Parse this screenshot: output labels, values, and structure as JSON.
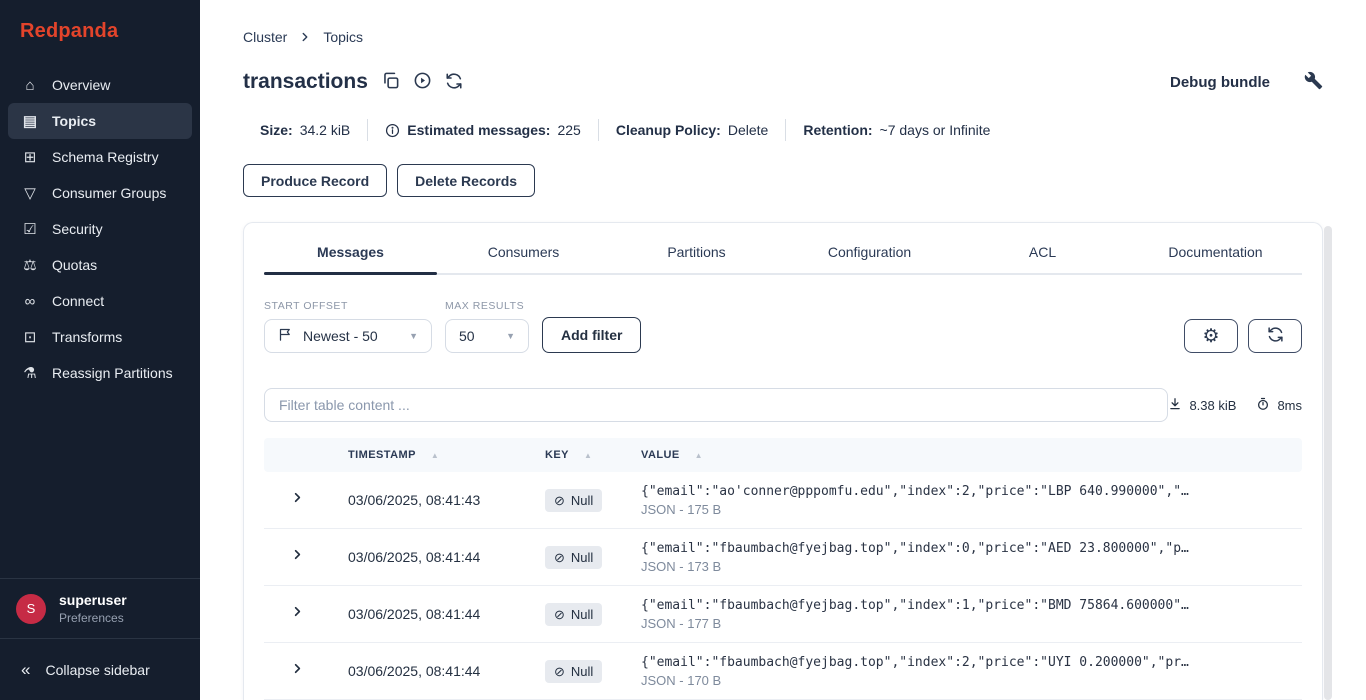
{
  "sidebar": {
    "logo": "Redpanda",
    "items": [
      {
        "label": "Overview",
        "icon": "home-icon",
        "glyph": "⌂",
        "active": false
      },
      {
        "label": "Topics",
        "icon": "topics-icon",
        "glyph": "▤",
        "active": true
      },
      {
        "label": "Schema Registry",
        "icon": "schema-registry-icon",
        "glyph": "⊞",
        "active": false
      },
      {
        "label": "Consumer Groups",
        "icon": "consumer-groups-icon",
        "glyph": "▽",
        "active": false
      },
      {
        "label": "Security",
        "icon": "security-shield-icon",
        "glyph": "☑",
        "active": false
      },
      {
        "label": "Quotas",
        "icon": "quotas-scales-icon",
        "glyph": "⚖",
        "active": false
      },
      {
        "label": "Connect",
        "icon": "connect-link-icon",
        "glyph": "∞",
        "active": false
      },
      {
        "label": "Transforms",
        "icon": "transforms-icon",
        "glyph": "⊡",
        "active": false
      },
      {
        "label": "Reassign Partitions",
        "icon": "reassign-partitions-icon",
        "glyph": "⚗",
        "active": false
      }
    ],
    "user": {
      "initial": "S",
      "name": "superuser",
      "sub": "Preferences"
    },
    "collapse_glyph": "«",
    "collapse_label": "Collapse sidebar"
  },
  "breadcrumb": {
    "crumb1": "Cluster",
    "crumb2": "Topics"
  },
  "header": {
    "title": "transactions",
    "debug_bundle_label": "Debug bundle"
  },
  "stats": [
    {
      "label": "Size:",
      "value": "34.2 kiB",
      "info": false
    },
    {
      "label": "Estimated messages:",
      "value": "225",
      "info": true
    },
    {
      "label": "Cleanup Policy:",
      "value": "Delete",
      "info": false
    },
    {
      "label": "Retention:",
      "value": "~7 days or Infinite",
      "info": false
    }
  ],
  "actions": {
    "produce_label": "Produce Record",
    "delete_label": "Delete Records"
  },
  "tabs": [
    {
      "label": "Messages",
      "active": true
    },
    {
      "label": "Consumers",
      "active": false
    },
    {
      "label": "Partitions",
      "active": false
    },
    {
      "label": "Configuration",
      "active": false
    },
    {
      "label": "ACL",
      "active": false
    },
    {
      "label": "Documentation",
      "active": false
    }
  ],
  "controls": {
    "start_offset_label": "START OFFSET",
    "start_offset_value": "Newest - 50",
    "max_results_label": "MAX RESULTS",
    "max_results_value": "50",
    "add_filter_label": "Add filter",
    "caret_glyph": "▼",
    "gear_glyph": "⚙"
  },
  "filterbar": {
    "placeholder": "Filter table content ...",
    "size": "8.38 kiB",
    "time": "8ms"
  },
  "table": {
    "columns": {
      "timestamp": "TIMESTAMP",
      "key": "KEY",
      "value": "VALUE"
    },
    "sort_glyph": "▲",
    "null_glyph": "⊘",
    "rows": [
      {
        "timestamp": "03/06/2025, 08:41:43",
        "key": "Null",
        "value": "{\"email\":\"ao'conner@pppomfu.edu\",\"index\":2,\"price\":\"LBP 640.990000\",\"…",
        "meta": "JSON - 175 B"
      },
      {
        "timestamp": "03/06/2025, 08:41:44",
        "key": "Null",
        "value": "{\"email\":\"fbaumbach@fyejbag.top\",\"index\":0,\"price\":\"AED 23.800000\",\"p…",
        "meta": "JSON - 173 B"
      },
      {
        "timestamp": "03/06/2025, 08:41:44",
        "key": "Null",
        "value": "{\"email\":\"fbaumbach@fyejbag.top\",\"index\":1,\"price\":\"BMD 75864.600000\"…",
        "meta": "JSON - 177 B"
      },
      {
        "timestamp": "03/06/2025, 08:41:44",
        "key": "Null",
        "value": "{\"email\":\"fbaumbach@fyejbag.top\",\"index\":2,\"price\":\"UYI 0.200000\",\"pr…",
        "meta": "JSON - 170 B"
      }
    ]
  },
  "colors": {
    "brand_red": "#E3442B",
    "sidebar_bg": "#151E2D",
    "text_navy": "#243047",
    "avatar_red": "#C62B45"
  }
}
